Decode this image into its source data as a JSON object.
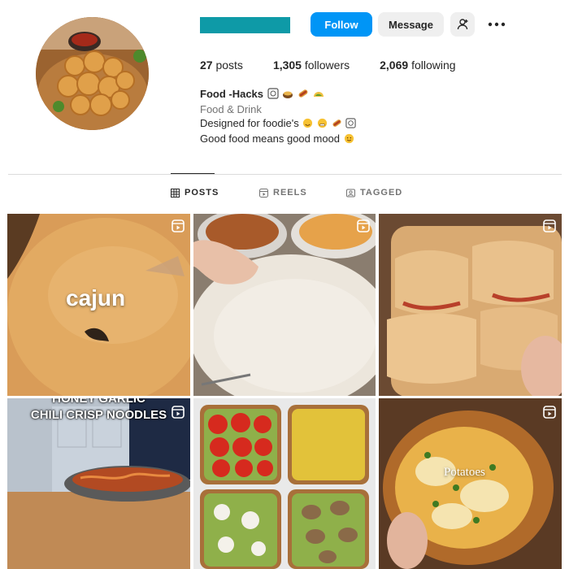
{
  "profile": {
    "avatar_alt": "fried chicken bites",
    "follow_label": "Follow",
    "message_label": "Message",
    "add_user_icon": "add-person-icon",
    "more_icon": "more-dots-icon",
    "brand_color": "#0e9aa7"
  },
  "stats": [
    {
      "count": "27",
      "label": "posts"
    },
    {
      "count": "1,305",
      "label": "followers"
    },
    {
      "count": "2,069",
      "label": "following"
    }
  ],
  "bio": {
    "name": "Food -Hacks",
    "category": "Food & Drink",
    "line1": "Designed for foodie's",
    "line2": "Good food means good mood"
  },
  "tabs": [
    {
      "label": "POSTS",
      "icon": "grid-icon",
      "active": true
    },
    {
      "label": "REELS",
      "icon": "reels-icon",
      "active": false
    },
    {
      "label": "TAGGED",
      "icon": "tagged-icon",
      "active": false
    }
  ],
  "posts": [
    {
      "overlay": "cajun",
      "type": "reel"
    },
    {
      "overlay": "",
      "type": "reel"
    },
    {
      "overlay": "",
      "type": "reel"
    },
    {
      "overlay_line1": "HONEY GARLIC",
      "overlay_line2": "CHILI CRISP NOODLES",
      "type": "reel"
    },
    {
      "overlay": "",
      "type": "image"
    },
    {
      "overlay": "Potatoes",
      "type": "reel"
    }
  ],
  "colors": {
    "follow": "#0095f6",
    "secondary_button": "#efefef",
    "muted": "#737373"
  }
}
